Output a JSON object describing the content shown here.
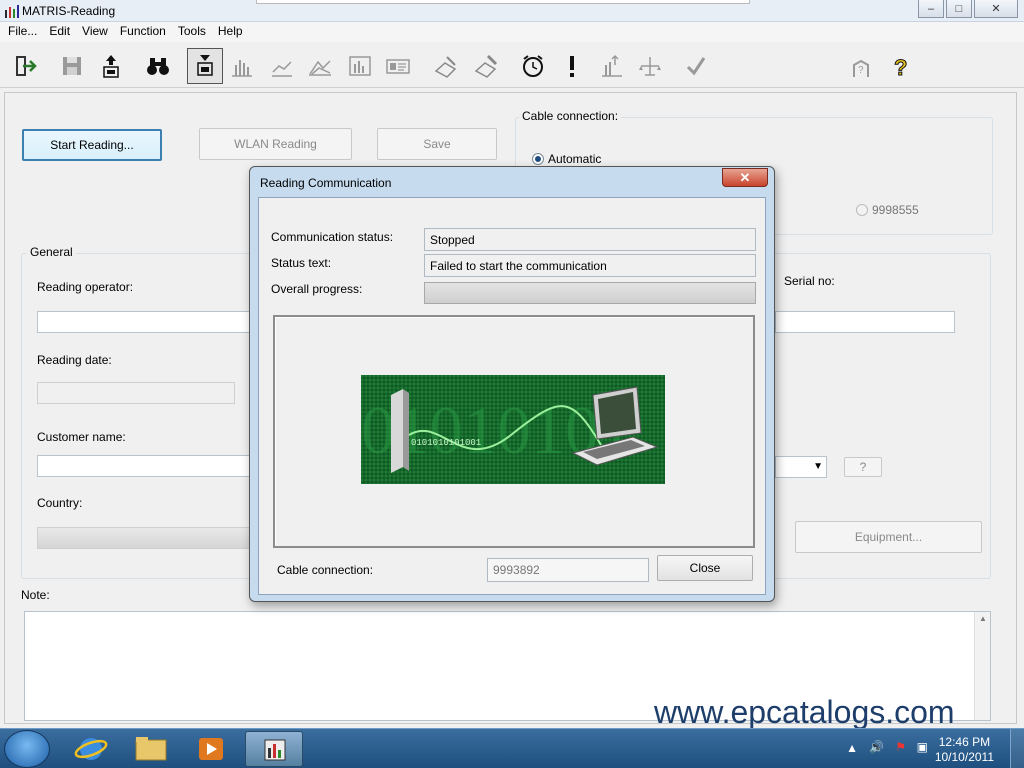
{
  "window": {
    "title": "MATRIS-Reading",
    "controls": {
      "minimize": "–",
      "maximize": "□",
      "close": "✕"
    }
  },
  "menu": [
    "File...",
    "Edit",
    "View",
    "Function",
    "Tools",
    "Help"
  ],
  "toolbar": {
    "icons": [
      "exit-icon",
      "save-disk-icon",
      "upload-icon",
      "binoculars-icon",
      "reading-icon",
      "bar-chart-icon",
      "line-chart-icon",
      "area-chart-icon",
      "report-icon",
      "card-icon",
      "hand-write-icon",
      "hand-erase-icon",
      "alarm-clock-icon",
      "exclamation-icon",
      "bar-arrow-icon",
      "balance-icon",
      "checkmark-icon",
      "help-hand-icon",
      "question-icon"
    ]
  },
  "main": {
    "start_reading": "Start Reading...",
    "wlan_reading": "WLAN Reading",
    "save": "Save",
    "cable_group": {
      "label": "Cable connection:",
      "automatic": "Automatic",
      "serial_option": "9998555"
    },
    "general": {
      "label": "General",
      "reading_operator": "Reading operator:",
      "reading_date": "Reading date:",
      "customer_name": "Customer name:",
      "country": "Country:",
      "serial_no": "Serial no:",
      "help_button": "?",
      "equipment_button": "Equipment..."
    },
    "note_label": "Note:"
  },
  "dialog": {
    "title": "Reading Communication",
    "close_x": "✕",
    "communication_status_label": "Communication status:",
    "communication_status_value": "Stopped",
    "status_text_label": "Status text:",
    "status_text_value": "Failed to start the communication",
    "overall_progress_label": "Overall progress:",
    "animation_text": "0101010101001",
    "cable_connection_label": "Cable connection:",
    "cable_connection_value": "9993892",
    "close_button": "Close"
  },
  "watermark": "www.epcatalogs.com",
  "taskbar": {
    "time": "12:46 PM",
    "date": "10/10/2011"
  }
}
